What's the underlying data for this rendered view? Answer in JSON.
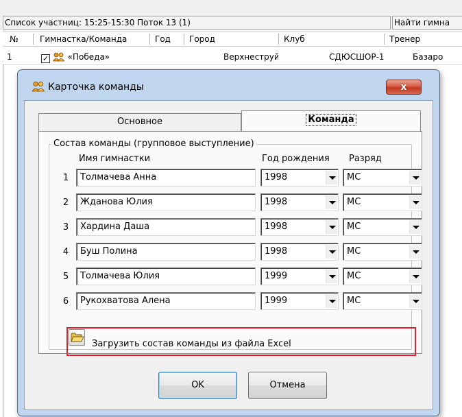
{
  "background": {
    "status_text": "Список участниц: 15:25-15:30 Поток 13 (1)",
    "find_text": "Найти гимна",
    "columns": [
      "№",
      "Гимнастка/Команда",
      "Год",
      "Город",
      "Клуб",
      "Тренер"
    ],
    "row": {
      "num": "1",
      "checked": "✓",
      "team": "«Победа»",
      "year": "",
      "city": "Верхнеструйск",
      "club": "СДЮСШОР-1...",
      "coach": "Базаро"
    }
  },
  "dialog": {
    "title": "Карточка команды",
    "close_symbol": "x",
    "tabs": [
      {
        "label": "Основное",
        "active": false
      },
      {
        "label": "Команда",
        "active": true
      }
    ],
    "group_title": "Состав команды (групповое выступление)",
    "headers": {
      "name": "Имя гимнастки",
      "birth_year": "Год рождения",
      "rank": "Разряд"
    },
    "members": [
      {
        "num": "1",
        "name": "Толмачева Анна",
        "year": "1998",
        "rank": "МС"
      },
      {
        "num": "2",
        "name": "Жданова Юлия",
        "year": "1998",
        "rank": "МС"
      },
      {
        "num": "3",
        "name": "Хардина Даша",
        "year": "1998",
        "rank": "МС"
      },
      {
        "num": "4",
        "name": "Буш Полина",
        "year": "1998",
        "rank": "МС"
      },
      {
        "num": "5",
        "name": "Толмачева Юлия",
        "year": "1999",
        "rank": "МС"
      },
      {
        "num": "6",
        "name": "Рукохватова Алена",
        "year": "1999",
        "rank": "МС"
      }
    ],
    "load_excel_label": "Загрузить состав команды из файла Excel",
    "ok_label": "OK",
    "cancel_label": "Отмена"
  },
  "colors": {
    "highlight": "#e0202a",
    "dialog_frame": "#bfd6ee",
    "close_button": "#c2371f"
  },
  "icons": {
    "team": "group-people-icon",
    "folder": "folder-open-icon",
    "close": "close-icon",
    "dropdown": "chevron-down-icon"
  }
}
